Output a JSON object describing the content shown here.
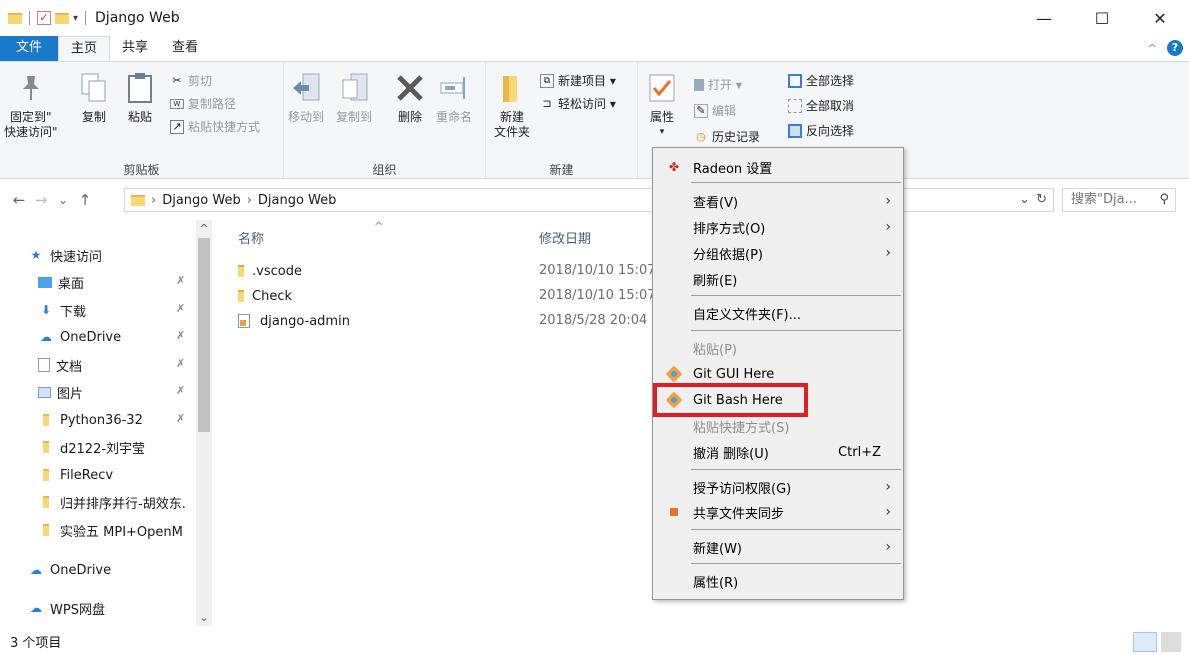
{
  "window": {
    "title": "Django Web",
    "minimize": "—",
    "maximize": "☐",
    "close": "✕"
  },
  "tabs": [
    "文件",
    "主页",
    "共享",
    "查看"
  ],
  "ribbon": {
    "clipboard": {
      "label": "剪贴板",
      "pin_line1": "固定到\"",
      "pin_line2": "快速访问\"",
      "copy": "复制",
      "paste": "粘贴",
      "cut": "剪切",
      "copy_path": "复制路径",
      "paste_shortcut": "粘贴快捷方式"
    },
    "organize": {
      "label": "组织",
      "move_to": "移动到",
      "copy_to": "复制到",
      "delete": "删除",
      "rename": "重命名"
    },
    "new": {
      "label": "新建",
      "new_folder_line1": "新建",
      "new_folder_line2": "文件夹",
      "new_item": "新建项目 ▾",
      "easy_access": "轻松访问 ▾"
    },
    "open": {
      "properties": "属性",
      "open": "打开 ▾",
      "edit": "编辑",
      "history": "历史记录"
    },
    "select": {
      "select_all": "全部选择",
      "select_none": "全部取消",
      "invert": "反向选择"
    }
  },
  "address": {
    "crumb1": "Django Web",
    "crumb2": "Django Web",
    "search_placeholder": "搜索\"Dja...",
    "back": "←",
    "forward": "→",
    "recent": "⌄",
    "up": "↑"
  },
  "navpane": {
    "items": [
      {
        "label": "快速访问",
        "pinned": false
      },
      {
        "label": "桌面",
        "pinned": true
      },
      {
        "label": "下载",
        "pinned": true
      },
      {
        "label": "OneDrive",
        "pinned": true
      },
      {
        "label": "文档",
        "pinned": true
      },
      {
        "label": "图片",
        "pinned": true
      },
      {
        "label": "Python36-32",
        "pinned": true
      },
      {
        "label": "d2122-刘宇莹",
        "pinned": false
      },
      {
        "label": "FileRecv",
        "pinned": false
      },
      {
        "label": "归并排序并行-胡效东.",
        "pinned": false
      },
      {
        "label": "实验五 MPI+OpenM",
        "pinned": false
      },
      {
        "label": "OneDrive",
        "pinned": false
      },
      {
        "label": "WPS网盘",
        "pinned": false
      }
    ],
    "pin_glyph": "📌"
  },
  "filelist": {
    "col_name": "名称",
    "col_date": "修改日期",
    "rows": [
      {
        "name": ".vscode",
        "date": "2018/10/10 15:07"
      },
      {
        "name": "Check",
        "date": "2018/10/10 15:07"
      },
      {
        "name": "django-admin",
        "date": "2018/5/28 20:04"
      }
    ]
  },
  "status": {
    "count": "3 个项目"
  },
  "context_menu": {
    "radeon": "Radeon 设置",
    "view": "查看(V)",
    "sort": "排序方式(O)",
    "group": "分组依据(P)",
    "refresh": "刷新(E)",
    "customize": "自定义文件夹(F)...",
    "paste": "粘贴(P)",
    "git_gui": "Git GUI Here",
    "git_bash": "Git Bash Here",
    "paste_shortcut": "粘贴快捷方式(S)",
    "undo": "撤消 删除(U)",
    "undo_shortcut": "Ctrl+Z",
    "give_access": "授予访问权限(G)",
    "share_sync": "共享文件夹同步",
    "new": "新建(W)",
    "properties": "属性(R)"
  },
  "colors": {
    "file_tab": "#1979ca",
    "highlight": "#e01c24",
    "folder": "#f8d775"
  }
}
